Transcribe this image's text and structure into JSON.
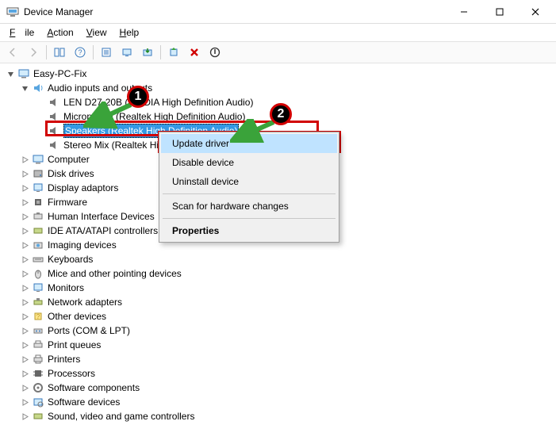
{
  "window": {
    "title": "Device Manager"
  },
  "menu": {
    "file": "File",
    "action": "Action",
    "view": "View",
    "help": "Help"
  },
  "tree": {
    "root": "Easy-PC-Fix",
    "audio": {
      "label": "Audio inputs and outputs",
      "items": [
        "LEN D27-20B (NVIDIA High Definition Audio)",
        "Microphone (Realtek High Definition Audio)",
        "Speakers (Realtek High Definition Audio)",
        "Stereo Mix (Realtek High Definition Audio)"
      ]
    },
    "categories": [
      "Computer",
      "Disk drives",
      "Display adaptors",
      "Firmware",
      "Human Interface Devices",
      "IDE ATA/ATAPI controllers",
      "Imaging devices",
      "Keyboards",
      "Mice and other pointing devices",
      "Monitors",
      "Network adapters",
      "Other devices",
      "Ports (COM & LPT)",
      "Print queues",
      "Printers",
      "Processors",
      "Software components",
      "Software devices",
      "Sound, video and game controllers"
    ]
  },
  "context_menu": {
    "update": "Update driver",
    "disable": "Disable device",
    "uninstall": "Uninstall device",
    "scan": "Scan for hardware changes",
    "properties": "Properties"
  },
  "annotations": {
    "badge1": "1",
    "badge2": "2"
  }
}
